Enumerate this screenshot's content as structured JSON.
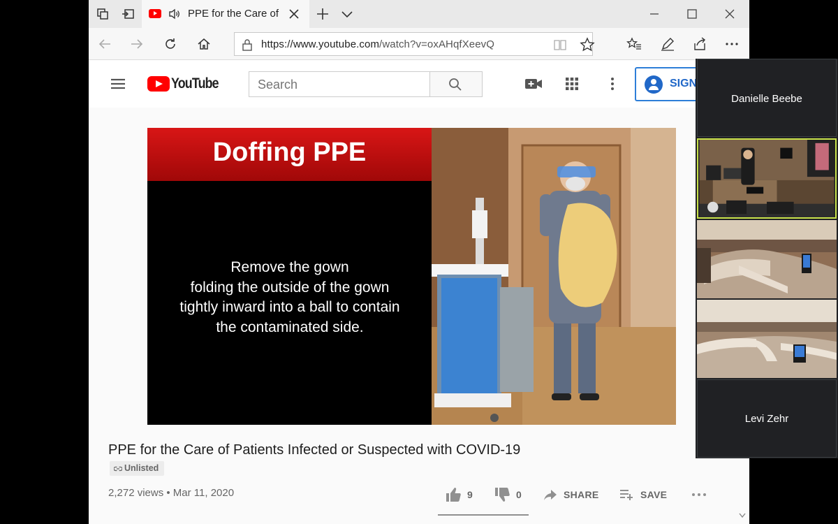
{
  "browser": {
    "tab_title": "PPE for the Care of",
    "url_host": "https://www.youtube.com",
    "url_path": "/watch?v=oxAHqfXeevQ"
  },
  "youtube": {
    "logo_text": "YouTube",
    "search_placeholder": "Search",
    "sign_in_label": "SIGN"
  },
  "video": {
    "slide_title": "Doffing PPE",
    "slide_lines": [
      "Remove the gown",
      "folding the outside of the gown",
      "tightly inward into a ball to contain",
      "the contaminated side."
    ],
    "title": "PPE for the Care of Patients Infected or Suspected with COVID-19",
    "badge": "Unlisted",
    "views_date": "2,272 views • Mar 11, 2020",
    "likes": "9",
    "dislikes": "0",
    "share_label": "SHARE",
    "save_label": "SAVE"
  },
  "participants": {
    "top_name": "Danielle Beebe",
    "bottom_name": "Levi Zehr"
  },
  "colors": {
    "youtube_red": "#ff0000",
    "slide_red": "#c40f0f",
    "link_blue": "#2168c8",
    "active_speaker": "#c9e34a"
  }
}
